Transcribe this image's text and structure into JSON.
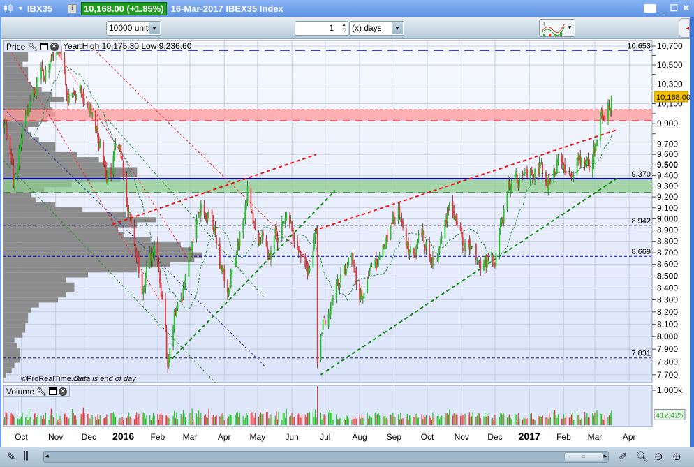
{
  "titlebar": {
    "symbol": "IBX35",
    "price_change": "10,168.00 (+1.85%)",
    "date_title": "16-Mar-2017 IBEX35 Index",
    "info_glyph": "i",
    "icons": [
      "candlestick-icon",
      "chevron-down-icon",
      "info-icon",
      "keyboard-icon",
      "minimize-icon",
      "maximize-icon",
      "close-icon"
    ]
  },
  "toolbar": {
    "units_value": "10000 units",
    "period_value": "1",
    "period_unit": "(x) days",
    "icons": [
      "add-indicator-icon",
      "chevron-down-icon",
      "side-panel-toggle-icon"
    ]
  },
  "price_panel": {
    "label": "Price",
    "year_info": "Year:High 10,175.30 Low 9,236.60",
    "copyright": "©ProRealTime.com",
    "eod_note": "Data is end of day",
    "last_price_label": "10,168.00",
    "last_price": 10168,
    "level_labels": [
      {
        "value": 10653,
        "text": "10,653"
      },
      {
        "value": 9370,
        "text": "9,370"
      },
      {
        "value": 8942,
        "text": "8,942"
      },
      {
        "value": 8669,
        "text": "8,669"
      },
      {
        "value": 7831,
        "text": "7,831"
      }
    ]
  },
  "volume_panel": {
    "label": "Volume",
    "axis_label": "1,000k",
    "last_volume_label": "412,425",
    "last_volume": 412425
  },
  "colors": {
    "up": "#22c322",
    "down": "#e03a3a",
    "level": "#0000cc",
    "accent_price": "#f5c400",
    "profile": "#8c8c8c"
  },
  "chart_data": {
    "type": "candlestick",
    "title": "IBEX35 Index",
    "scale": "log",
    "ylim": [
      7650,
      10800
    ],
    "start_date": "2015-09-15",
    "end_date": "2017-03-16",
    "yticks": [
      {
        "v": 10700,
        "t": "10,700"
      },
      {
        "v": 10500,
        "t": "10,500"
      },
      {
        "v": 10300,
        "t": "10,300"
      },
      {
        "v": 10100,
        "t": "10,100"
      },
      {
        "v": 9900,
        "t": "9,900"
      },
      {
        "v": 9700,
        "t": "9,700"
      },
      {
        "v": 9600,
        "t": "9,600"
      },
      {
        "v": 9500,
        "t": "9,500",
        "bold": true
      },
      {
        "v": 9400,
        "t": "9,400"
      },
      {
        "v": 9300,
        "t": "9,300"
      },
      {
        "v": 9200,
        "t": "9,200"
      },
      {
        "v": 9100,
        "t": "9,100"
      },
      {
        "v": 9000,
        "t": "9,000",
        "bold": true
      },
      {
        "v": 8900,
        "t": "8,900"
      },
      {
        "v": 8800,
        "t": "8,800"
      },
      {
        "v": 8700,
        "t": "8,700"
      },
      {
        "v": 8600,
        "t": "8,600"
      },
      {
        "v": 8500,
        "t": "8,500",
        "bold": true
      },
      {
        "v": 8400,
        "t": "8,400"
      },
      {
        "v": 8300,
        "t": "8,300"
      },
      {
        "v": 8200,
        "t": "8,200"
      },
      {
        "v": 8100,
        "t": "8,100"
      },
      {
        "v": 8000,
        "t": "8,000",
        "bold": true
      },
      {
        "v": 7900,
        "t": "7,900"
      },
      {
        "v": 7800,
        "t": "7,800"
      },
      {
        "v": 7700,
        "t": "7,700"
      }
    ],
    "minor_ticks": [
      10600,
      10400,
      10200,
      10000,
      9800
    ],
    "xticks": [
      {
        "d": "2015-10-01",
        "t": "Oct"
      },
      {
        "d": "2015-11-01",
        "t": "Nov"
      },
      {
        "d": "2015-12-01",
        "t": "Dec"
      },
      {
        "d": "2016-01-01",
        "t": "2016",
        "bold": true
      },
      {
        "d": "2016-02-01",
        "t": "Feb"
      },
      {
        "d": "2016-03-01",
        "t": "Mar"
      },
      {
        "d": "2016-04-01",
        "t": "Apr"
      },
      {
        "d": "2016-05-01",
        "t": "May"
      },
      {
        "d": "2016-06-01",
        "t": "Jun"
      },
      {
        "d": "2016-07-01",
        "t": "Jul"
      },
      {
        "d": "2016-08-01",
        "t": "Aug"
      },
      {
        "d": "2016-09-01",
        "t": "Sep"
      },
      {
        "d": "2016-10-01",
        "t": "Oct"
      },
      {
        "d": "2016-11-01",
        "t": "Nov"
      },
      {
        "d": "2016-12-01",
        "t": "Dec"
      },
      {
        "d": "2017-01-01",
        "t": "2017",
        "bold": true
      },
      {
        "d": "2017-02-01",
        "t": "Feb"
      },
      {
        "d": "2017-03-01",
        "t": "Mar"
      },
      {
        "d": "2017-04-01",
        "t": "Apr"
      }
    ],
    "close_keypoints": [
      [
        "2015-09-15",
        9850
      ],
      [
        "2015-09-17",
        9900
      ],
      [
        "2015-09-24",
        9300
      ],
      [
        "2015-10-04",
        9900
      ],
      [
        "2015-10-13",
        10200
      ],
      [
        "2015-10-23",
        10450
      ],
      [
        "2015-11-04",
        10600
      ],
      [
        "2015-11-14",
        10150
      ],
      [
        "2015-11-23",
        10300
      ],
      [
        "2015-12-03",
        10000
      ],
      [
        "2015-12-15",
        9500
      ],
      [
        "2015-12-22",
        9400
      ],
      [
        "2015-12-25",
        9700
      ],
      [
        "2015-12-31",
        9550
      ],
      [
        "2016-01-03",
        9300
      ],
      [
        "2016-01-09",
        8900
      ],
      [
        "2016-01-19",
        8400
      ],
      [
        "2016-01-28",
        8700
      ],
      [
        "2016-02-05",
        8300
      ],
      [
        "2016-02-10",
        7760
      ],
      [
        "2016-02-16",
        8200
      ],
      [
        "2016-02-24",
        8400
      ],
      [
        "2016-03-03",
        8800
      ],
      [
        "2016-03-12",
        9100
      ],
      [
        "2016-03-22",
        8900
      ],
      [
        "2016-04-03",
        8350
      ],
      [
        "2016-04-13",
        8800
      ],
      [
        "2016-04-22",
        9300
      ],
      [
        "2016-04-29",
        8900
      ],
      [
        "2016-05-11",
        8700
      ],
      [
        "2016-05-27",
        9050
      ],
      [
        "2016-06-05",
        8800
      ],
      [
        "2016-06-15",
        8500
      ],
      [
        "2016-06-23",
        8900
      ],
      [
        "2016-06-24",
        7790
      ],
      [
        "2016-06-30",
        8150
      ],
      [
        "2016-07-16",
        8500
      ],
      [
        "2016-07-26",
        8600
      ],
      [
        "2016-08-01",
        8300
      ],
      [
        "2016-08-17",
        8600
      ],
      [
        "2016-08-26",
        8800
      ],
      [
        "2016-09-05",
        9100
      ],
      [
        "2016-09-14",
        8700
      ],
      [
        "2016-09-30",
        8800
      ],
      [
        "2016-10-09",
        8650
      ],
      [
        "2016-10-22",
        9200
      ],
      [
        "2016-10-31",
        8900
      ],
      [
        "2016-11-13",
        8650
      ],
      [
        "2016-12-01",
        8600
      ],
      [
        "2016-12-07",
        9000
      ],
      [
        "2016-12-16",
        9350
      ],
      [
        "2017-01-01",
        9400
      ],
      [
        "2017-01-11",
        9500
      ],
      [
        "2017-01-20",
        9350
      ],
      [
        "2017-01-26",
        9550
      ],
      [
        "2017-02-05",
        9300
      ],
      [
        "2017-02-14",
        9550
      ],
      [
        "2017-02-24",
        9450
      ],
      [
        "2017-03-02",
        9700
      ],
      [
        "2017-03-08",
        9950
      ],
      [
        "2017-03-11",
        10050
      ],
      [
        "2017-03-16",
        10168
      ]
    ],
    "bands": [
      {
        "from": 9930,
        "to": 10040,
        "fill": "#ff9a9a",
        "edge": "#ff2020"
      },
      {
        "from": 9240,
        "to": 9370,
        "fill": "#8fcc8f",
        "edge": "#1a6a1a"
      }
    ],
    "levels": [
      {
        "value": 10653,
        "color": "#0000dd",
        "style": "longdash"
      },
      {
        "value": 9370,
        "color": "#0000cc",
        "style": "solid"
      },
      {
        "value": 8942,
        "color": "#222255",
        "style": "dash"
      },
      {
        "value": 8669,
        "color": "#0000cc",
        "style": "dash"
      },
      {
        "value": 7831,
        "color": "#222255",
        "style": "dash"
      }
    ],
    "trendlines": [
      {
        "from": [
          "2015-12-22",
          8950
        ],
        "to": [
          "2016-06-23",
          9600
        ],
        "color": "#ee1111",
        "width": 2,
        "dash": "5,4"
      },
      {
        "from": [
          "2016-06-21",
          8896
        ],
        "to": [
          "2017-03-22",
          9844
        ],
        "color": "#ee1111",
        "width": 2,
        "dash": "5,4"
      },
      {
        "from": [
          "2016-02-10",
          7790
        ],
        "to": [
          "2016-07-10",
          9260
        ],
        "color": "#118811",
        "width": 2,
        "dash": "5,4"
      },
      {
        "from": [
          "2016-06-27",
          7700
        ],
        "to": [
          "2017-03-22",
          9380
        ],
        "color": "#118811",
        "width": 2,
        "dash": "5,4"
      },
      {
        "from": [
          "2015-11-04",
          10610
        ],
        "to": [
          "2016-02-29",
          8640
        ],
        "color": "#ee2222",
        "width": 1,
        "dash": "3,3"
      },
      {
        "from": [
          "2015-12-05",
          10670
        ],
        "to": [
          "2016-06-18",
          8620
        ],
        "color": "#ee2222",
        "width": 1,
        "dash": "3,3"
      },
      {
        "from": [
          "2015-09-15",
          10780
        ],
        "to": [
          "2016-02-03",
          8290
        ],
        "color": "#ee2222",
        "width": 1,
        "dash": "3,3"
      },
      {
        "from": [
          "2015-09-15",
          10050
        ],
        "to": [
          "2016-05-07",
          7770
        ],
        "color": "#2233aa",
        "width": 1,
        "dash": "3,3"
      },
      {
        "from": [
          "2015-09-15",
          9541
        ],
        "to": [
          "2016-03-25",
          7630
        ],
        "color": "#228822",
        "width": 1,
        "dash": "3,3"
      },
      {
        "from": [
          "2015-12-15",
          9980
        ],
        "to": [
          "2016-05-07",
          8320
        ],
        "color": "#228822",
        "width": 1,
        "dash": "3,3"
      }
    ],
    "volume_spike": {
      "date": "2016-06-24",
      "value": 1120000
    }
  },
  "bottombar": {
    "scroll_grip": "≡",
    "icons": [
      "drawing-tools-icon",
      "chart-style-icon",
      "scroll-left-icon",
      "scroll-right-icon",
      "drawing-properties-icon",
      "auto-zoom-icon",
      "zoom-out-icon",
      "zoom-in-icon"
    ]
  }
}
